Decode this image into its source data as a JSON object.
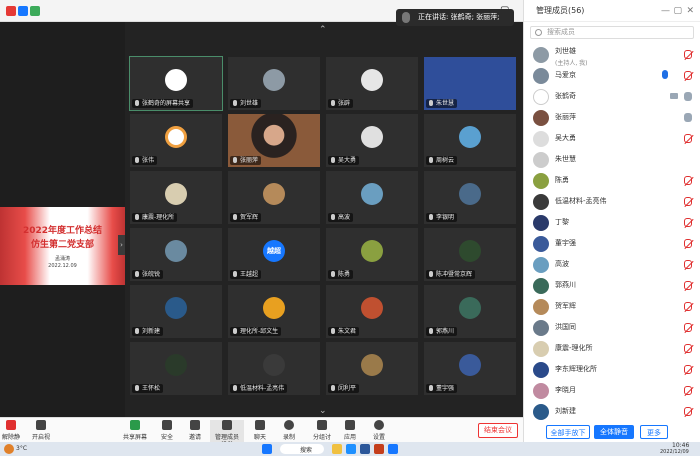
{
  "meeting": {
    "speaking_label": "正在讲话: 张鹤奇; 张丽萍;",
    "grid_tiles": [
      {
        "name": "张鹤奇的屏幕共享",
        "kind": "logo",
        "photo": "#ffffff"
      },
      {
        "name": "刘世雄",
        "kind": "photo",
        "photo": "#8d9aa5"
      },
      {
        "name": "张辟",
        "kind": "default",
        "photo": "#e6e6e6"
      },
      {
        "name": "朱世慧",
        "kind": "photo",
        "photo": "#2f4e9a"
      },
      {
        "name": "张伟",
        "kind": "logo",
        "photo": "#f0a040"
      },
      {
        "name": "张丽萍",
        "kind": "video",
        "photo": "#7a5040"
      },
      {
        "name": "吴大勇",
        "kind": "photo",
        "photo": "#e0e0e0"
      },
      {
        "name": "周树云",
        "kind": "photo",
        "photo": "#5aa0d0"
      },
      {
        "name": "康震-理化所",
        "kind": "photo",
        "photo": "#d8cdb0"
      },
      {
        "name": "贺军辉",
        "kind": "photo",
        "photo": "#b58a5a"
      },
      {
        "name": "高波",
        "kind": "photo",
        "photo": "#6a9ec0"
      },
      {
        "name": "李银明",
        "kind": "photo",
        "photo": "#4a6a8a"
      },
      {
        "name": "张皖锐",
        "kind": "photo",
        "photo": "#6a8aa0"
      },
      {
        "name": "王越超",
        "kind": "text",
        "photo": "#1677ff",
        "badge": "越超"
      },
      {
        "name": "陈勇",
        "kind": "photo",
        "photo": "#8aa040"
      },
      {
        "name": "陈冲暨常京辉",
        "kind": "photo",
        "photo": "#2e4a2e"
      },
      {
        "name": "刘新建",
        "kind": "photo",
        "photo": "#2a5a8a"
      },
      {
        "name": "理化所-邱文生",
        "kind": "photo",
        "photo": "#e8a020"
      },
      {
        "name": "朱文君",
        "kind": "photo",
        "photo": "#c05030"
      },
      {
        "name": "郭燕川",
        "kind": "photo",
        "photo": "#3a6a5a"
      },
      {
        "name": "王怀松",
        "kind": "photo",
        "photo": "#2a3a2a"
      },
      {
        "name": "低温材料-孟亮伟",
        "kind": "photo",
        "photo": "#3a3a3a"
      },
      {
        "name": "闵利平",
        "kind": "photo",
        "photo": "#9a7a4a"
      },
      {
        "name": "董宇强",
        "kind": "photo",
        "photo": "#3a5a9a"
      }
    ]
  },
  "shared_slide": {
    "line1": "2022年度工作总结",
    "line2": "仿生第二党支部",
    "line3": "孟涌涛",
    "line4": "2022.12.09"
  },
  "participants": {
    "title": "管理成员(56)",
    "search_placeholder": "搜索成员",
    "items": [
      {
        "name": "刘世雄",
        "sub": "(主持人, 我)",
        "mic": "off",
        "color": "#8d9aa5"
      },
      {
        "name": "马爱京",
        "sub": "",
        "mic": "off",
        "hand": true,
        "color": "#7a8a9a"
      },
      {
        "name": "张鹤奇",
        "sub": "",
        "mic": "on",
        "video": true,
        "color": "#ffffff"
      },
      {
        "name": "张丽萍",
        "sub": "",
        "mic": "on",
        "color": "#7a5040"
      },
      {
        "name": "吴大勇",
        "sub": "",
        "mic": "off",
        "color": "#dddddd"
      },
      {
        "name": "朱世慧",
        "sub": "",
        "mic": "none",
        "color": "#cccccc"
      },
      {
        "name": "陈勇",
        "sub": "",
        "mic": "off",
        "color": "#8aa040"
      },
      {
        "name": "低温材料-孟亮伟",
        "sub": "",
        "mic": "off",
        "color": "#3a3a3a"
      },
      {
        "name": "丁黎",
        "sub": "",
        "mic": "off",
        "color": "#2a3a6a"
      },
      {
        "name": "董宇强",
        "sub": "",
        "mic": "off",
        "color": "#3a5a9a"
      },
      {
        "name": "高波",
        "sub": "",
        "mic": "off",
        "color": "#6a9ec0"
      },
      {
        "name": "郭燕川",
        "sub": "",
        "mic": "off",
        "color": "#3a6a5a"
      },
      {
        "name": "贺军辉",
        "sub": "",
        "mic": "off",
        "color": "#b58a5a"
      },
      {
        "name": "洪国同",
        "sub": "",
        "mic": "off",
        "color": "#6a7a8a"
      },
      {
        "name": "康震-理化所",
        "sub": "",
        "mic": "off",
        "color": "#d8cdb0"
      },
      {
        "name": "李东辉理化所",
        "sub": "",
        "mic": "off",
        "color": "#2a4a8a"
      },
      {
        "name": "李晓月",
        "sub": "",
        "mic": "off",
        "color": "#c08aa0"
      },
      {
        "name": "刘新建",
        "sub": "",
        "mic": "off",
        "color": "#2a5a8a"
      }
    ],
    "btn_mute_all_hands": "全部手放下",
    "btn_mute_all": "全体静音",
    "btn_more": "更多"
  },
  "toolbar": {
    "mute": "解除静音",
    "video": "开启视频",
    "share": "共享屏幕",
    "security": "安全",
    "invite": "邀请",
    "members": "管理成员(56)",
    "chat": "聊天",
    "record": "录制",
    "breakout": "分组讨论",
    "apps": "应用",
    "settings": "设置",
    "end": "结束会议"
  },
  "taskbar": {
    "weather": "3°C",
    "search": "搜索",
    "time": "10:46",
    "date": "2022/12/09"
  },
  "colors": {
    "accent": "#1677ff",
    "danger": "#e03030",
    "dark": "#232323"
  }
}
